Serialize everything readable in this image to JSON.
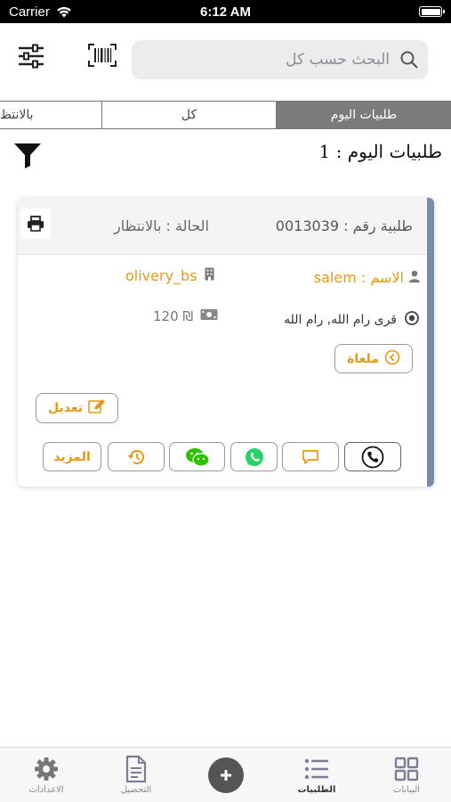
{
  "status_bar": {
    "carrier": "Carrier",
    "time": "6:12 AM"
  },
  "header": {
    "search_placeholder": "البحث حسب كل",
    "icons": [
      "settings-sliders-icon",
      "barcode-icon",
      "search-icon"
    ]
  },
  "tabs": [
    {
      "label": "طلبيات اليوم",
      "selected": true
    },
    {
      "label": "كل",
      "selected": false
    },
    {
      "label": "بالانتظار",
      "selected": false
    }
  ],
  "tab_visible_labels": {
    "today": "طلبيات اليوم",
    "all": "كل",
    "waiting": "بالانتظ"
  },
  "orders_heading": "طلبيات اليوم : 1",
  "order_card": {
    "order_number": "طلبية رقم : 0013039",
    "status": "الحالة : بالانتظار",
    "name": "الاسم : salem",
    "company": "olivery_bs",
    "address": "قرى رام الله, رام الله",
    "price": "120 ₪",
    "cancelled_label": "ملغاة",
    "edit_label": "تعديل",
    "more_label": "المزيد",
    "accent_color": "#7c8ba5",
    "highlight_color": "#e69a10"
  },
  "bottom_nav": {
    "settings": "الاعدادات",
    "collection": "التحصيل",
    "orders": "الطلبيات",
    "data": "البيانات"
  }
}
